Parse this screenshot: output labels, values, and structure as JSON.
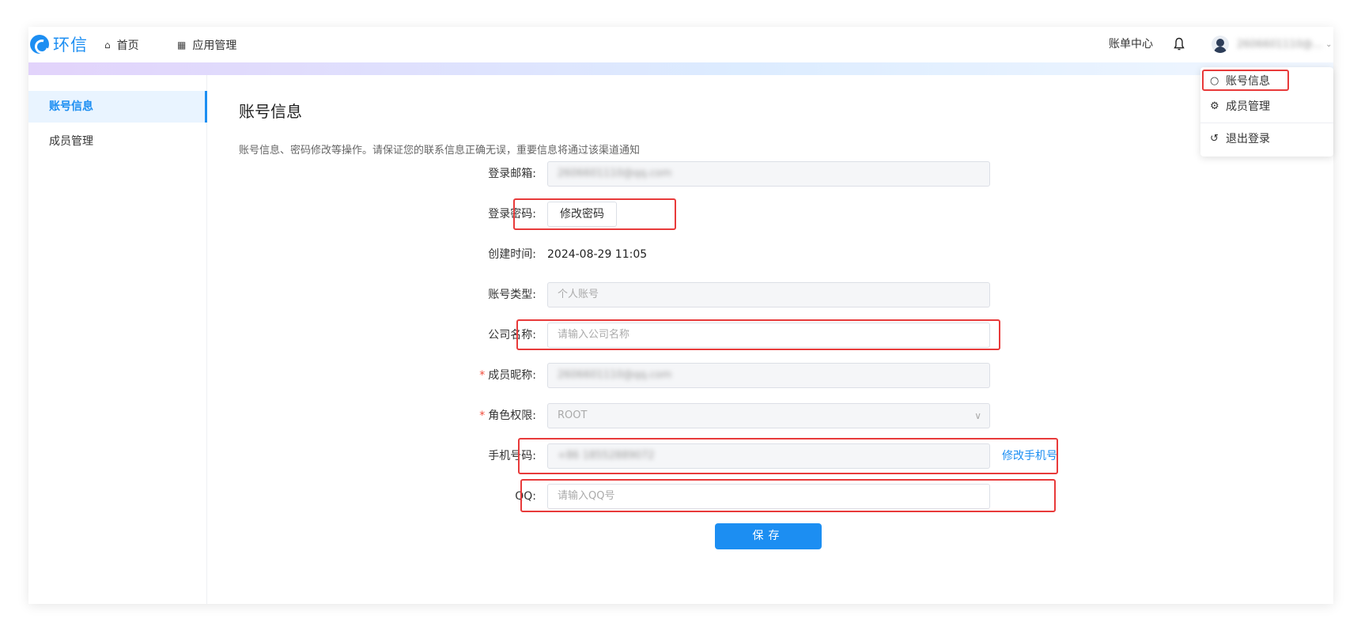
{
  "header": {
    "logo_text": "环信",
    "nav_home": "首页",
    "nav_apps": "应用管理",
    "billing": "账单中心",
    "user_name": "2606601110@..."
  },
  "sidebar": {
    "items": [
      {
        "label": "账号信息",
        "active": true
      },
      {
        "label": "成员管理",
        "active": false
      }
    ]
  },
  "main": {
    "title": "账号信息",
    "description": "账号信息、密码修改等操作。请保证您的联系信息正确无误，重要信息将通过该渠道通知",
    "login_email": {
      "label": "登录邮箱:",
      "value": "2606601110@qq.com"
    },
    "login_password": {
      "label": "登录密码:",
      "button": "修改密码"
    },
    "created_time": {
      "label": "创建时间:",
      "value": "2024-08-29 11:05"
    },
    "account_type": {
      "label": "账号类型:",
      "value": "个人账号"
    },
    "company_name": {
      "label": "公司名称:",
      "placeholder": "请输入公司名称"
    },
    "member_nickname": {
      "label": "成员昵称:",
      "required": "*",
      "value": "2606601110@qq.com"
    },
    "role": {
      "label": "角色权限:",
      "required": "*",
      "value": "ROOT"
    },
    "phone": {
      "label": "手机号码:",
      "value": "+86 18552889072",
      "link": "修改手机号"
    },
    "qq": {
      "label": "QQ:",
      "placeholder": "请输入QQ号"
    },
    "save_button": "保存"
  },
  "user_menu": {
    "items": [
      {
        "label": "账号信息",
        "icon": "user-icon"
      },
      {
        "label": "成员管理",
        "icon": "gear-icon"
      },
      {
        "label": "退出登录",
        "icon": "logout-icon"
      }
    ]
  },
  "colors": {
    "accent": "#1c8ef2",
    "highlight": "#e83a3a"
  }
}
